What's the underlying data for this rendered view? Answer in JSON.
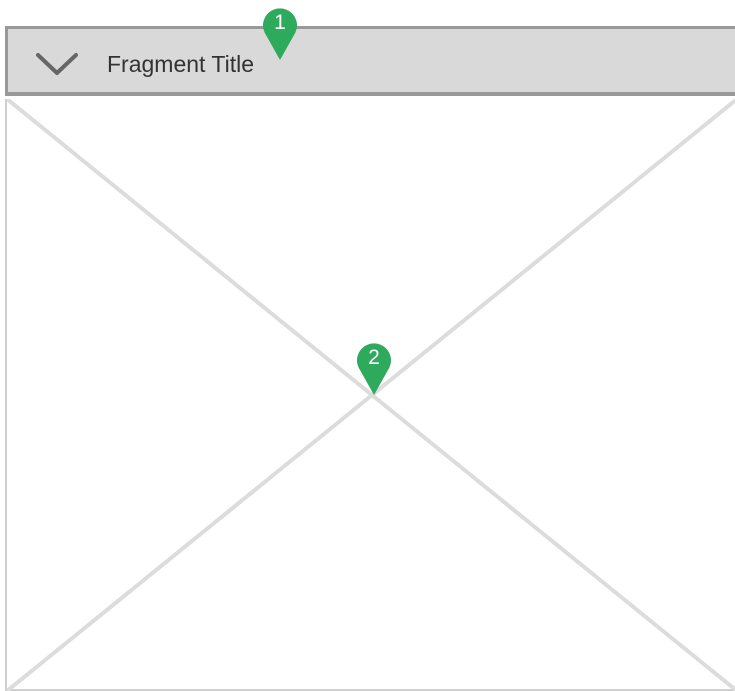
{
  "fragment": {
    "title": "Fragment Title",
    "collapse_icon": "chevron-down-icon",
    "content_placeholder": "image-placeholder"
  },
  "annotations": [
    {
      "label": "1"
    },
    {
      "label": "2"
    }
  ],
  "colors": {
    "header_bg": "#d9d9d9",
    "header_border": "#999999",
    "placeholder_lines": "#dcdcdc",
    "pin": "#2eaa5c"
  }
}
